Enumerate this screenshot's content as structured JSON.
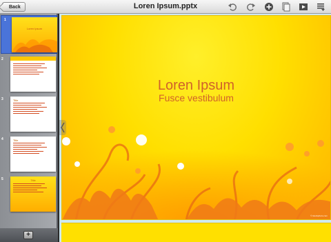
{
  "toolbar": {
    "back_label": "Back",
    "document_title": "Loren Ipsum.pptx",
    "icons": [
      "undo-icon",
      "redo-icon",
      "add-icon",
      "slides-icon",
      "play-icon",
      "settings-icon"
    ]
  },
  "sidebar": {
    "slides": [
      {
        "number": "1",
        "title": "Loren Ipsum",
        "selected": true
      },
      {
        "number": "2",
        "title": "",
        "selected": false
      },
      {
        "number": "3",
        "title": "Title",
        "selected": false
      },
      {
        "number": "4",
        "title": "Title",
        "selected": false
      },
      {
        "number": "5",
        "title": "Title",
        "selected": false
      }
    ],
    "add_label": "+"
  },
  "slide": {
    "title": "Loren Ipsum",
    "subtitle": "Fusce vestibulum",
    "credit": "© istockphoto.com"
  },
  "colors": {
    "slide_text": "#d0612a",
    "selection": "#4a74d9",
    "slide_background": "#ffdf00"
  }
}
